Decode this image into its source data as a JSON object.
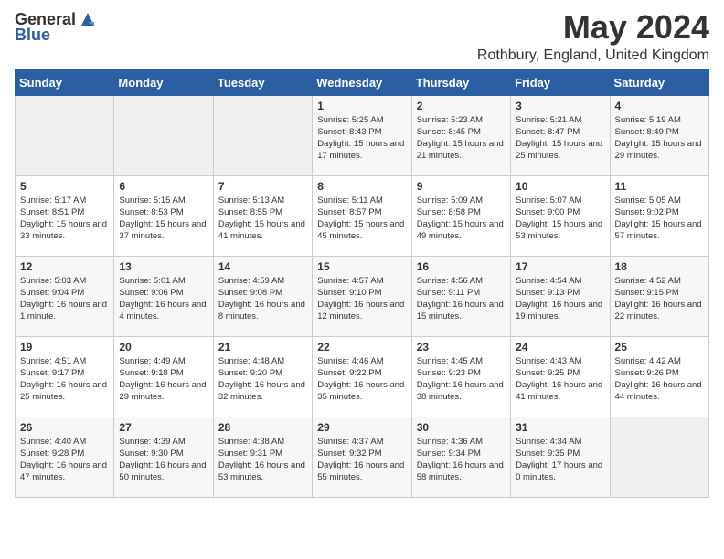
{
  "app": {
    "logo_general": "General",
    "logo_blue": "Blue"
  },
  "header": {
    "title": "May 2024",
    "subtitle": "Rothbury, England, United Kingdom"
  },
  "days_of_week": [
    "Sunday",
    "Monday",
    "Tuesday",
    "Wednesday",
    "Thursday",
    "Friday",
    "Saturday"
  ],
  "weeks": [
    [
      {
        "day": "",
        "sunrise": "",
        "sunset": "",
        "daylight": "",
        "empty": true
      },
      {
        "day": "",
        "sunrise": "",
        "sunset": "",
        "daylight": "",
        "empty": true
      },
      {
        "day": "",
        "sunrise": "",
        "sunset": "",
        "daylight": "",
        "empty": true
      },
      {
        "day": "1",
        "sunrise": "Sunrise: 5:25 AM",
        "sunset": "Sunset: 8:43 PM",
        "daylight": "Daylight: 15 hours and 17 minutes."
      },
      {
        "day": "2",
        "sunrise": "Sunrise: 5:23 AM",
        "sunset": "Sunset: 8:45 PM",
        "daylight": "Daylight: 15 hours and 21 minutes."
      },
      {
        "day": "3",
        "sunrise": "Sunrise: 5:21 AM",
        "sunset": "Sunset: 8:47 PM",
        "daylight": "Daylight: 15 hours and 25 minutes."
      },
      {
        "day": "4",
        "sunrise": "Sunrise: 5:19 AM",
        "sunset": "Sunset: 8:49 PM",
        "daylight": "Daylight: 15 hours and 29 minutes."
      }
    ],
    [
      {
        "day": "5",
        "sunrise": "Sunrise: 5:17 AM",
        "sunset": "Sunset: 8:51 PM",
        "daylight": "Daylight: 15 hours and 33 minutes."
      },
      {
        "day": "6",
        "sunrise": "Sunrise: 5:15 AM",
        "sunset": "Sunset: 8:53 PM",
        "daylight": "Daylight: 15 hours and 37 minutes."
      },
      {
        "day": "7",
        "sunrise": "Sunrise: 5:13 AM",
        "sunset": "Sunset: 8:55 PM",
        "daylight": "Daylight: 15 hours and 41 minutes."
      },
      {
        "day": "8",
        "sunrise": "Sunrise: 5:11 AM",
        "sunset": "Sunset: 8:57 PM",
        "daylight": "Daylight: 15 hours and 45 minutes."
      },
      {
        "day": "9",
        "sunrise": "Sunrise: 5:09 AM",
        "sunset": "Sunset: 8:58 PM",
        "daylight": "Daylight: 15 hours and 49 minutes."
      },
      {
        "day": "10",
        "sunrise": "Sunrise: 5:07 AM",
        "sunset": "Sunset: 9:00 PM",
        "daylight": "Daylight: 15 hours and 53 minutes."
      },
      {
        "day": "11",
        "sunrise": "Sunrise: 5:05 AM",
        "sunset": "Sunset: 9:02 PM",
        "daylight": "Daylight: 15 hours and 57 minutes."
      }
    ],
    [
      {
        "day": "12",
        "sunrise": "Sunrise: 5:03 AM",
        "sunset": "Sunset: 9:04 PM",
        "daylight": "Daylight: 16 hours and 1 minute."
      },
      {
        "day": "13",
        "sunrise": "Sunrise: 5:01 AM",
        "sunset": "Sunset: 9:06 PM",
        "daylight": "Daylight: 16 hours and 4 minutes."
      },
      {
        "day": "14",
        "sunrise": "Sunrise: 4:59 AM",
        "sunset": "Sunset: 9:08 PM",
        "daylight": "Daylight: 16 hours and 8 minutes."
      },
      {
        "day": "15",
        "sunrise": "Sunrise: 4:57 AM",
        "sunset": "Sunset: 9:10 PM",
        "daylight": "Daylight: 16 hours and 12 minutes."
      },
      {
        "day": "16",
        "sunrise": "Sunrise: 4:56 AM",
        "sunset": "Sunset: 9:11 PM",
        "daylight": "Daylight: 16 hours and 15 minutes."
      },
      {
        "day": "17",
        "sunrise": "Sunrise: 4:54 AM",
        "sunset": "Sunset: 9:13 PM",
        "daylight": "Daylight: 16 hours and 19 minutes."
      },
      {
        "day": "18",
        "sunrise": "Sunrise: 4:52 AM",
        "sunset": "Sunset: 9:15 PM",
        "daylight": "Daylight: 16 hours and 22 minutes."
      }
    ],
    [
      {
        "day": "19",
        "sunrise": "Sunrise: 4:51 AM",
        "sunset": "Sunset: 9:17 PM",
        "daylight": "Daylight: 16 hours and 25 minutes."
      },
      {
        "day": "20",
        "sunrise": "Sunrise: 4:49 AM",
        "sunset": "Sunset: 9:18 PM",
        "daylight": "Daylight: 16 hours and 29 minutes."
      },
      {
        "day": "21",
        "sunrise": "Sunrise: 4:48 AM",
        "sunset": "Sunset: 9:20 PM",
        "daylight": "Daylight: 16 hours and 32 minutes."
      },
      {
        "day": "22",
        "sunrise": "Sunrise: 4:46 AM",
        "sunset": "Sunset: 9:22 PM",
        "daylight": "Daylight: 16 hours and 35 minutes."
      },
      {
        "day": "23",
        "sunrise": "Sunrise: 4:45 AM",
        "sunset": "Sunset: 9:23 PM",
        "daylight": "Daylight: 16 hours and 38 minutes."
      },
      {
        "day": "24",
        "sunrise": "Sunrise: 4:43 AM",
        "sunset": "Sunset: 9:25 PM",
        "daylight": "Daylight: 16 hours and 41 minutes."
      },
      {
        "day": "25",
        "sunrise": "Sunrise: 4:42 AM",
        "sunset": "Sunset: 9:26 PM",
        "daylight": "Daylight: 16 hours and 44 minutes."
      }
    ],
    [
      {
        "day": "26",
        "sunrise": "Sunrise: 4:40 AM",
        "sunset": "Sunset: 9:28 PM",
        "daylight": "Daylight: 16 hours and 47 minutes."
      },
      {
        "day": "27",
        "sunrise": "Sunrise: 4:39 AM",
        "sunset": "Sunset: 9:30 PM",
        "daylight": "Daylight: 16 hours and 50 minutes."
      },
      {
        "day": "28",
        "sunrise": "Sunrise: 4:38 AM",
        "sunset": "Sunset: 9:31 PM",
        "daylight": "Daylight: 16 hours and 53 minutes."
      },
      {
        "day": "29",
        "sunrise": "Sunrise: 4:37 AM",
        "sunset": "Sunset: 9:32 PM",
        "daylight": "Daylight: 16 hours and 55 minutes."
      },
      {
        "day": "30",
        "sunrise": "Sunrise: 4:36 AM",
        "sunset": "Sunset: 9:34 PM",
        "daylight": "Daylight: 16 hours and 58 minutes."
      },
      {
        "day": "31",
        "sunrise": "Sunrise: 4:34 AM",
        "sunset": "Sunset: 9:35 PM",
        "daylight": "Daylight: 17 hours and 0 minutes."
      },
      {
        "day": "",
        "sunrise": "",
        "sunset": "",
        "daylight": "",
        "empty": true
      }
    ]
  ]
}
